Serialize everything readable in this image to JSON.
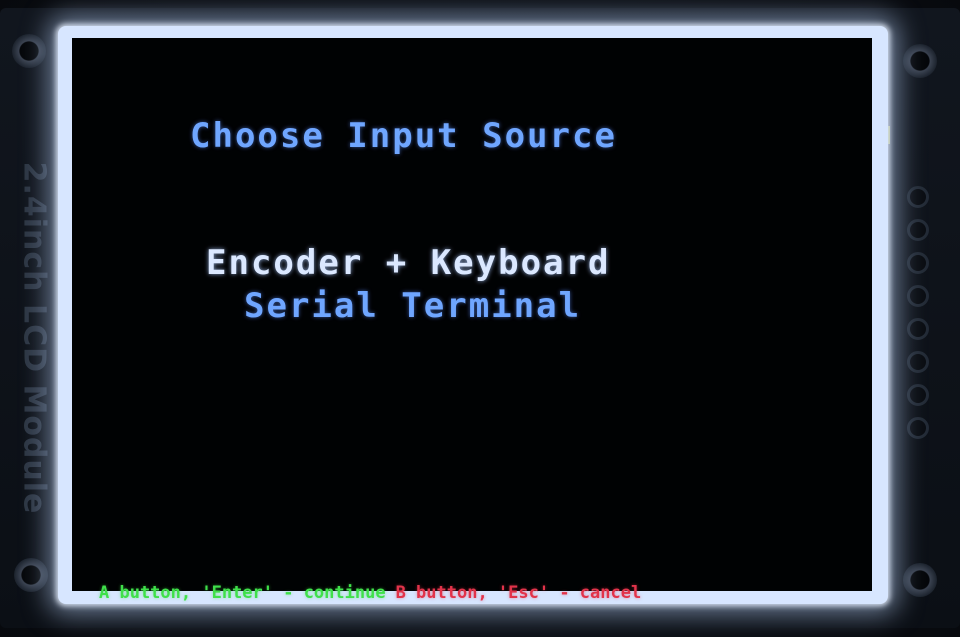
{
  "board": {
    "silkscreen_label": "2.4inch LCD Module"
  },
  "screen": {
    "title": "Choose Input Source",
    "options": [
      {
        "label": "Encoder + Keyboard",
        "selected": true
      },
      {
        "label": "Serial Terminal",
        "selected": false
      }
    ],
    "footer": {
      "continue_hint": "A button, 'Enter' - continue",
      "cancel_hint": "B button, 'Esc' - cancel"
    }
  },
  "colors": {
    "title": "#6fa6ff",
    "selected_option": "#dbe8ff",
    "option": "#6fa6ff",
    "continue_hint": "#3fe04a",
    "cancel_hint": "#e2334a",
    "screen_background": "#000203"
  }
}
